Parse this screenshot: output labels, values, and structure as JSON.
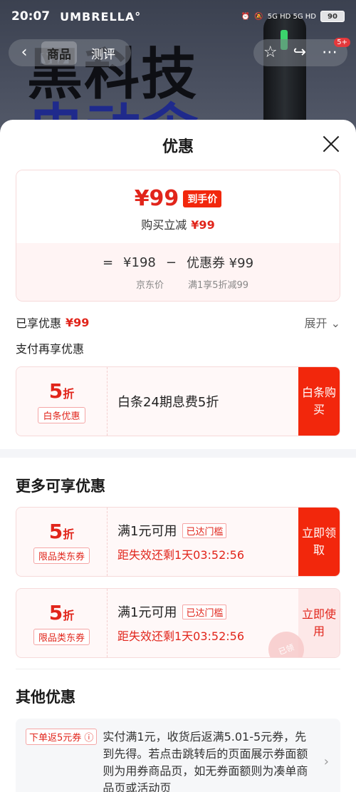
{
  "status": {
    "time": "20:07",
    "brand": "UMBRELLA°",
    "network": "5G HD 5G HD",
    "battery": "90"
  },
  "hero": {
    "line1": "黑科技",
    "line2": "电动伞"
  },
  "nav": {
    "tabs": [
      {
        "label": "商品"
      },
      {
        "label": "测评"
      }
    ],
    "badge": "5+"
  },
  "sheet": {
    "title": "优惠",
    "summary": {
      "final_price": "¥99",
      "final_tag": "到手价",
      "save_label": "购买立减",
      "save_amount": "¥99",
      "eq": "=",
      "minus": "−",
      "base_price": "¥198",
      "coupon": "优惠券 ¥99",
      "base_label": "京东价",
      "coupon_label": "满1享5折减99"
    },
    "enjoyed": {
      "label": "已享优惠",
      "amount": "¥99",
      "expand": "展开 ⌄"
    },
    "pay_more": "支付再享优惠",
    "baitiao": {
      "discount": "5",
      "unit": "折",
      "tag": "白条优惠",
      "title": "白条24期息费5折",
      "action": "白条购买"
    },
    "more_title": "更多可享优惠",
    "coupons": [
      {
        "discount": "5",
        "unit": "折",
        "tag": "限品类东券",
        "title": "满1元可用",
        "badge": "已达门槛",
        "expire": "距失效还剩1天03:52:56",
        "action": "立即领取"
      },
      {
        "discount": "5",
        "unit": "折",
        "tag": "限品类东券",
        "title": "满1元可用",
        "badge": "已达门槛",
        "expire": "距失效还剩1天03:52:56",
        "action": "立即使用",
        "stamp": "已领"
      }
    ],
    "other_title": "其他优惠",
    "other": {
      "tag": "下单返5元券 ⓘ",
      "text": "实付满1元，收货后返满5.01-5元券，先到先得。若点击跳转后的页面展示券面额则为用券商品页，如无券面额则为凑单商品页或活动页"
    }
  }
}
